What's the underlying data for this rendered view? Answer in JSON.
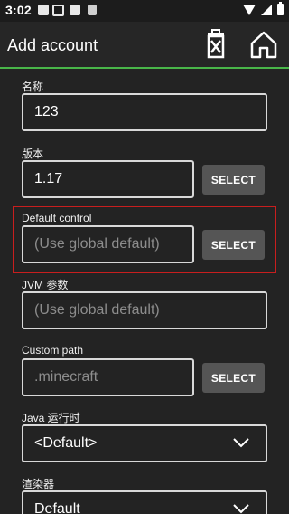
{
  "status_bar": {
    "time": "3:02",
    "icons": [
      "notification-a-icon",
      "notification-box-icon",
      "image-icon",
      "file-icon",
      "wifi-icon",
      "signal-icon",
      "battery-icon"
    ]
  },
  "toolbar": {
    "title": "Add account",
    "delete_icon": "delete-icon",
    "home_icon": "home-icon",
    "accent_color": "#49b649"
  },
  "form": {
    "name": {
      "label": "名称",
      "value": "123"
    },
    "version": {
      "label": "版本",
      "value": "1.17",
      "button": "SELECT"
    },
    "default_control": {
      "label": "Default control",
      "placeholder": "(Use global default)",
      "button": "SELECT"
    },
    "jvm_args": {
      "label": "JVM 参数",
      "placeholder": "(Use global default)"
    },
    "custom_path": {
      "label": "Custom path",
      "placeholder": ".minecraft",
      "button": "SELECT"
    },
    "java_runtime": {
      "label": "Java 运行时",
      "value": "<Default>"
    },
    "renderer": {
      "label": "渲染器",
      "value": "Default"
    }
  },
  "highlight_color": "#c81e1e"
}
